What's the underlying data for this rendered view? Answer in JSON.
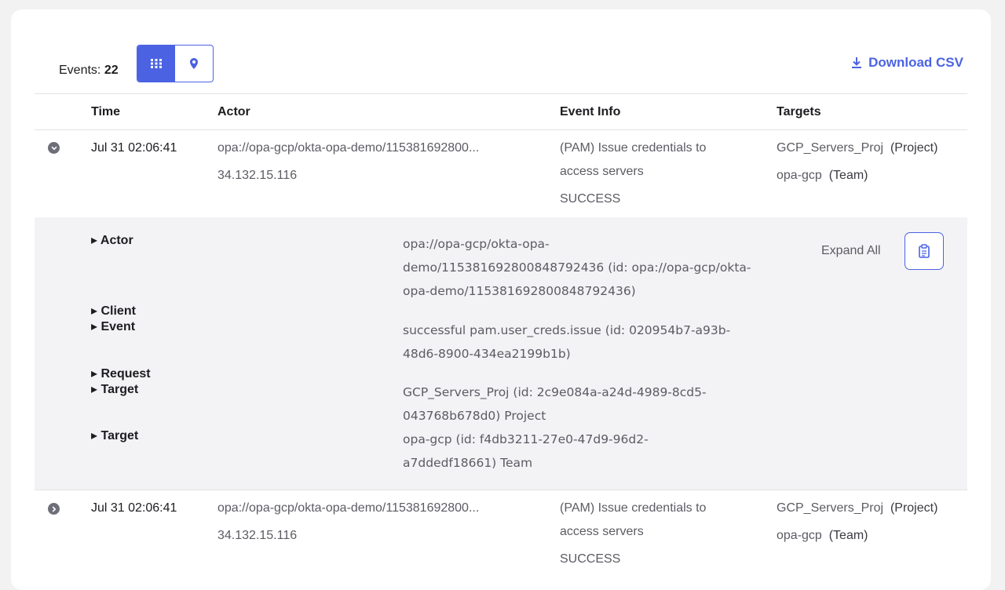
{
  "toolbar": {
    "events_prefix": "Events: ",
    "events_count": "22",
    "download_label": "Download CSV"
  },
  "table": {
    "headers": [
      "Time",
      "Actor",
      "Event Info",
      "Targets"
    ],
    "rows": [
      {
        "time": "Jul 31 02:06:41",
        "actor": "opa://opa-gcp/okta-opa-demo/115381692800...",
        "actor_ip": "34.132.15.116",
        "event_line1": "(PAM) Issue credentials to",
        "event_line2": "access servers",
        "event_status": "SUCCESS",
        "target1_name": "GCP_Servers_Proj",
        "target1_type": "(Project)",
        "target2_name": "opa-gcp",
        "target2_type": "(Team)"
      },
      {
        "time": "Jul 31 02:06:41",
        "actor": "opa://opa-gcp/okta-opa-demo/115381692800...",
        "actor_ip": "34.132.15.116",
        "event_line1": "(PAM) Issue credentials to",
        "event_line2": "access servers",
        "event_status": "SUCCESS",
        "target1_name": "GCP_Servers_Proj",
        "target1_type": "(Project)",
        "target2_name": "opa-gcp",
        "target2_type": "(Team)"
      }
    ]
  },
  "details": {
    "tree": [
      "Actor",
      "Client",
      "Event",
      "Request",
      "Target",
      "Target"
    ],
    "actor_l1": "opa://opa-gcp/okta-opa-",
    "actor_l2": "demo/115381692800848792436 (id: opa://opa-gcp/okta-",
    "actor_l3": "opa-demo/115381692800848792436)",
    "event_l1": "successful pam.user_creds.issue  (id: 020954b7-a93b-",
    "event_l2": "48d6-8900-434ea2199b1b)",
    "target1_l1": "GCP_Servers_Proj (id: 2c9e084a-a24d-4989-8cd5-",
    "target1_l2": "043768b678d0) Project",
    "target2_l1": "opa-gcp (id: f4db3211-27e0-47d9-96d2-",
    "target2_l2": "a7ddedf18661) Team",
    "expand_all": "Expand All"
  },
  "colors": {
    "accent": "#4b63e3"
  }
}
